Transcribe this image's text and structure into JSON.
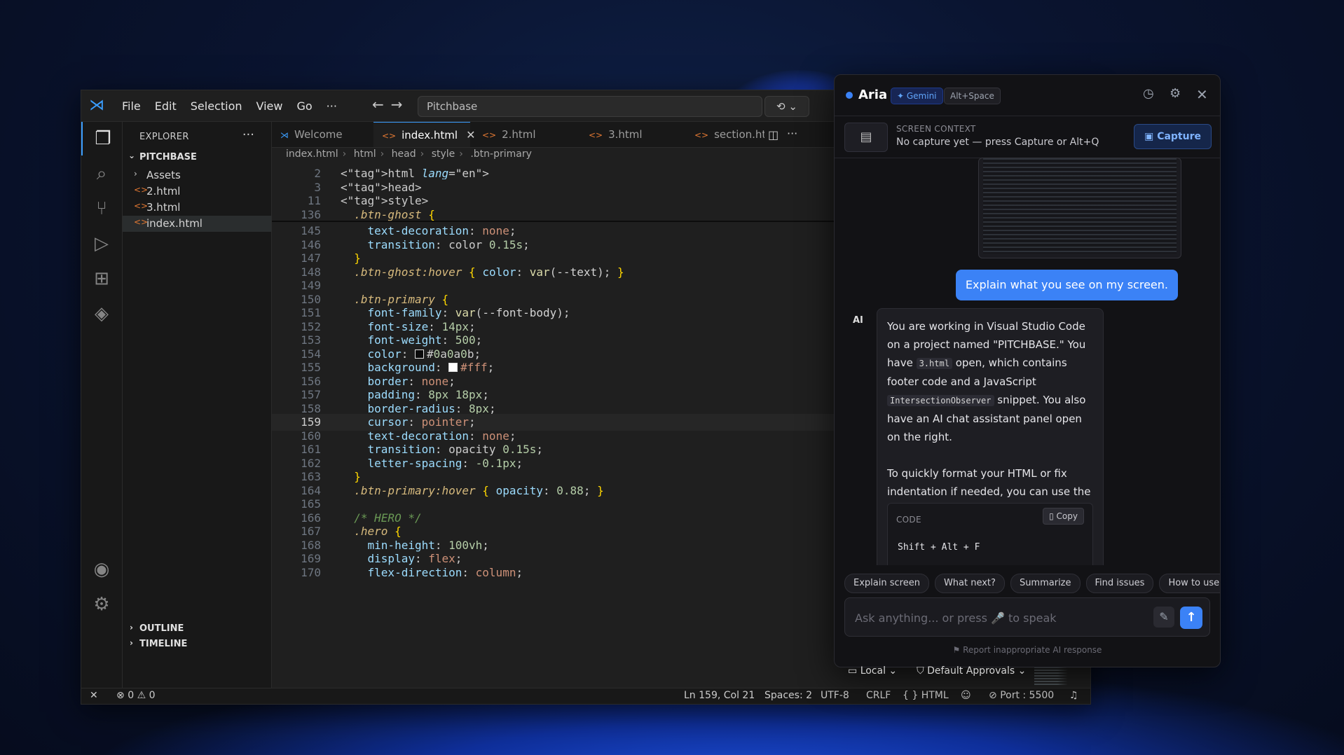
{
  "vscode": {
    "menu": [
      "File",
      "Edit",
      "Selection",
      "View",
      "Go",
      "···"
    ],
    "search": "Pitchbase",
    "explorer_title": "EXPLORER",
    "folder": "PITCHBASE",
    "tree": [
      {
        "label": "Assets",
        "type": "folder"
      },
      {
        "label": "2.html",
        "type": "file"
      },
      {
        "label": "3.html",
        "type": "file"
      },
      {
        "label": "index.html",
        "type": "file",
        "active": true
      }
    ],
    "outline": "OUTLINE",
    "timeline": "TIMELINE",
    "tabs": [
      {
        "label": "Welcome"
      },
      {
        "label": "index.html",
        "active": true
      },
      {
        "label": "2.html"
      },
      {
        "label": "3.html"
      },
      {
        "label": "section.htr"
      }
    ],
    "breadcrumb": [
      "index.html",
      "html",
      "head",
      "style",
      ".btn-primary"
    ],
    "status": {
      "errors": "0",
      "warnings": "0",
      "position": "Ln 159, Col 21",
      "spaces": "Spaces: 2",
      "encoding": "UTF-8",
      "eol": "CRLF",
      "language": "HTML",
      "port": "Port : 5500"
    },
    "code_lines": [
      {
        "n": "2",
        "text": "<html lang=\"en\">"
      },
      {
        "n": "3",
        "text": "<head>"
      },
      {
        "n": "11",
        "text": "<style>"
      },
      {
        "n": "136",
        "text": "  .btn-ghost {"
      },
      {
        "n": "145",
        "text": "    text-decoration: none;"
      },
      {
        "n": "146",
        "text": "    transition: color 0.15s;"
      },
      {
        "n": "147",
        "text": "  }"
      },
      {
        "n": "148",
        "text": "  .btn-ghost:hover { color: var(--text); }"
      },
      {
        "n": "149",
        "text": ""
      },
      {
        "n": "150",
        "text": "  .btn-primary {"
      },
      {
        "n": "151",
        "text": "    font-family: var(--font-body);"
      },
      {
        "n": "152",
        "text": "    font-size: 14px;"
      },
      {
        "n": "153",
        "text": "    font-weight: 500;"
      },
      {
        "n": "154",
        "text": "    color: #0a0a0b;"
      },
      {
        "n": "155",
        "text": "    background: #fff;"
      },
      {
        "n": "156",
        "text": "    border: none;"
      },
      {
        "n": "157",
        "text": "    padding: 8px 18px;"
      },
      {
        "n": "158",
        "text": "    border-radius: 8px;"
      },
      {
        "n": "159",
        "text": "    cursor: pointer;"
      },
      {
        "n": "160",
        "text": "    text-decoration: none;"
      },
      {
        "n": "161",
        "text": "    transition: opacity 0.15s;"
      },
      {
        "n": "162",
        "text": "    letter-spacing: -0.1px;"
      },
      {
        "n": "163",
        "text": "  }"
      },
      {
        "n": "164",
        "text": "  .btn-primary:hover { opacity: 0.88; }"
      },
      {
        "n": "165",
        "text": ""
      },
      {
        "n": "166",
        "text": "  /* HERO */"
      },
      {
        "n": "167",
        "text": "  .hero {"
      },
      {
        "n": "168",
        "text": "    min-height: 100vh;"
      },
      {
        "n": "169",
        "text": "    display: flex;"
      },
      {
        "n": "170",
        "text": "    flex-direction: column;"
      }
    ],
    "current_line": "159"
  },
  "aria": {
    "title": "Aria",
    "model_badge": "✦ Gemini",
    "shortcut_badge": "Alt+Space",
    "context_label": "SCREEN CONTEXT",
    "context_status": "No capture yet — press Capture or Alt+Q",
    "capture_label": "Capture",
    "user_message": "Explain what you see on my screen.",
    "ai_label": "AI",
    "ai_p1_a": "You are working in Visual Studio Code on a project named \"PITCHBASE.\" You have ",
    "ai_p1_code1": "3.html",
    "ai_p1_b": " open, which contains footer code and a JavaScript ",
    "ai_p1_code2": "IntersectionObserver",
    "ai_p1_c": " snippet. You also have an AI chat assistant panel open on the right.",
    "ai_p2": "To quickly format your HTML or fix indentation if needed, you can use the built-in formatter by pressing:",
    "code_head": "CODE",
    "copy_label": "Copy",
    "code_text": "Shift + Alt + F",
    "chips": [
      "Explain screen",
      "What next?",
      "Summarize",
      "Find issues",
      "How to use"
    ],
    "input_placeholder": "Ask anything... or press 🎤 to speak",
    "report": "⚑ Report inappropriate AI response"
  },
  "bottom_row": {
    "local": "Local ⌄",
    "approvals": "Default Approvals ⌄"
  },
  "colors": {
    "accent": "#3b82f6",
    "vscode_bg": "#1f1f1f",
    "aria_bg": "#121215"
  }
}
